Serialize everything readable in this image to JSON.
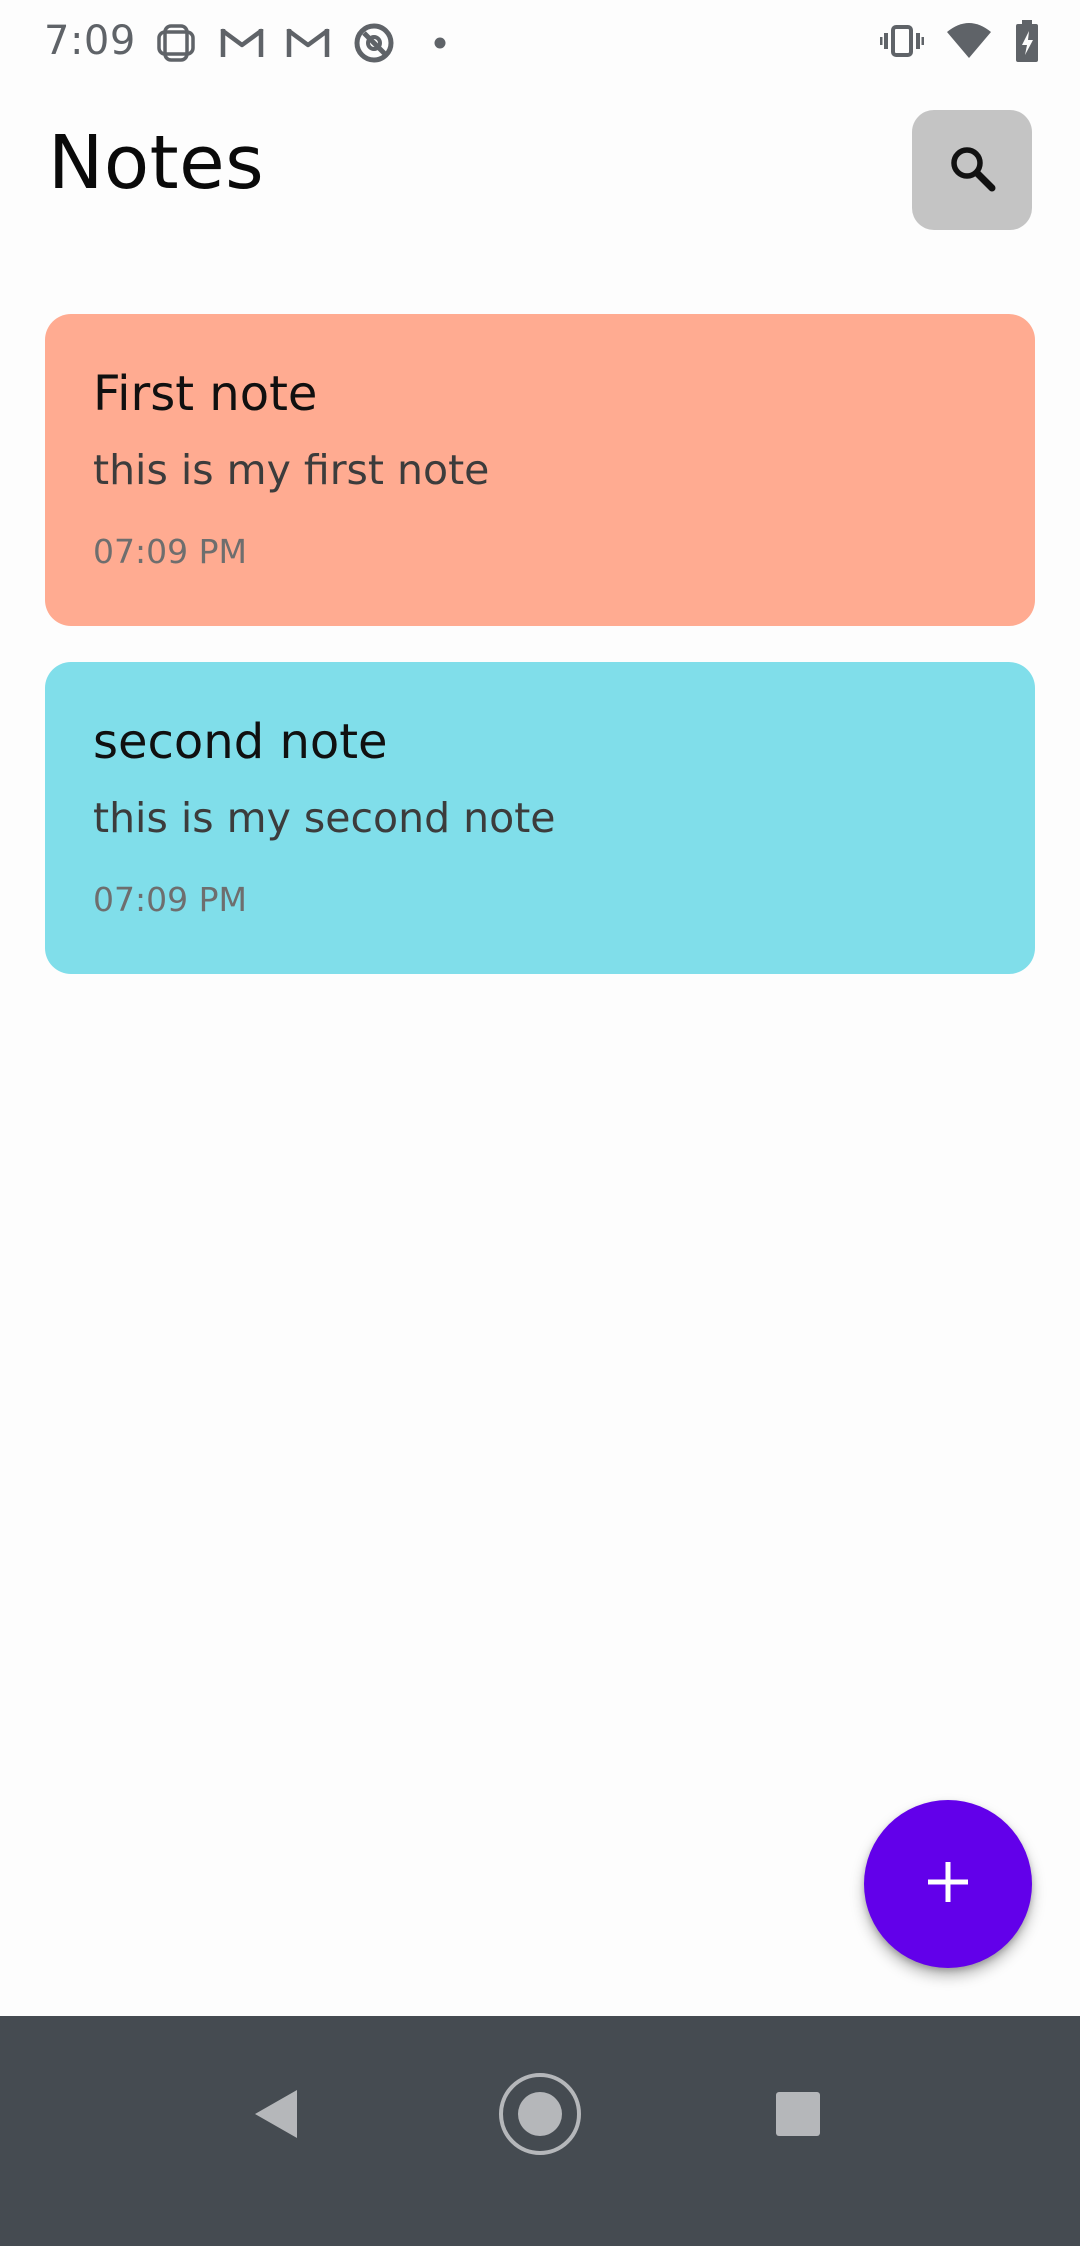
{
  "status_bar": {
    "time": "7:09",
    "notification_icons": [
      "grid-icon",
      "gmail-icon",
      "gmail-icon",
      "blocked-icon",
      "dot-icon"
    ],
    "right_icons": [
      "vibrate-icon",
      "wifi-icon",
      "battery-charging-icon"
    ]
  },
  "header": {
    "title": "Notes",
    "search_icon": "search-icon"
  },
  "notes": [
    {
      "title": "First note",
      "body": "this is my first note",
      "time": "07:09 PM",
      "color": "#ffab91"
    },
    {
      "title": "second note",
      "body": "this is my second note",
      "time": "07:09 PM",
      "color": "#80deea"
    }
  ],
  "fab": {
    "icon": "plus-icon",
    "color": "#6200ea"
  },
  "nav_bar": {
    "back_icon": "back-triangle-icon",
    "home_icon": "home-circle-icon",
    "recents_icon": "recents-square-icon"
  }
}
